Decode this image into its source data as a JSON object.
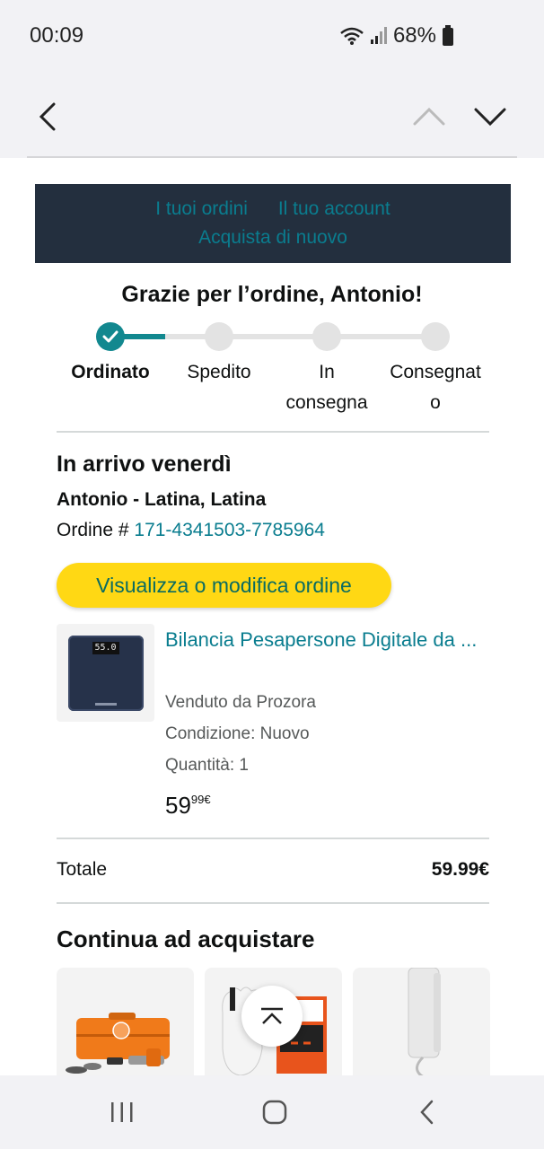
{
  "status_bar": {
    "time": "00:09",
    "battery": "68%"
  },
  "nav": {
    "back_icon": "chevron-left-icon",
    "prev_icon": "chevron-up-icon",
    "next_icon": "chevron-down-icon"
  },
  "header": {
    "link_orders": "I tuoi ordini",
    "link_account": "Il tuo account",
    "link_buy_again": "Acquista di nuovo"
  },
  "order": {
    "thanks": "Grazie per l’ordine, Antonio!",
    "steps": [
      {
        "label": "Ordinato",
        "done": true
      },
      {
        "label": "Spedito",
        "done": false
      },
      {
        "label": "In\nconsegna",
        "done": false
      },
      {
        "label": "Consegnat\no",
        "done": false
      }
    ],
    "progress_fraction": 0.17,
    "arrival": "In arrivo venerdì",
    "recipient": "Antonio - Latina, Latina",
    "order_label": "Ordine # ",
    "order_number": "171-4341503-7785964",
    "view_button": "Visualizza o modifica ordine"
  },
  "product": {
    "title": "Bilancia Pesapersone Digitale da ...",
    "seller": "Venduto da Prozora",
    "condition": "Condizione: Nuovo",
    "quantity": "Quantità: 1",
    "price_whole": "59",
    "price_fraction": "99€",
    "scale_display": "55.0"
  },
  "total": {
    "label": "Totale",
    "value": "59.99€"
  },
  "continue": {
    "title": "Continua ad acquistare"
  },
  "colors": {
    "accent": "#0a7d8f",
    "button_yellow": "#ffd814",
    "banner": "#232f3e"
  }
}
